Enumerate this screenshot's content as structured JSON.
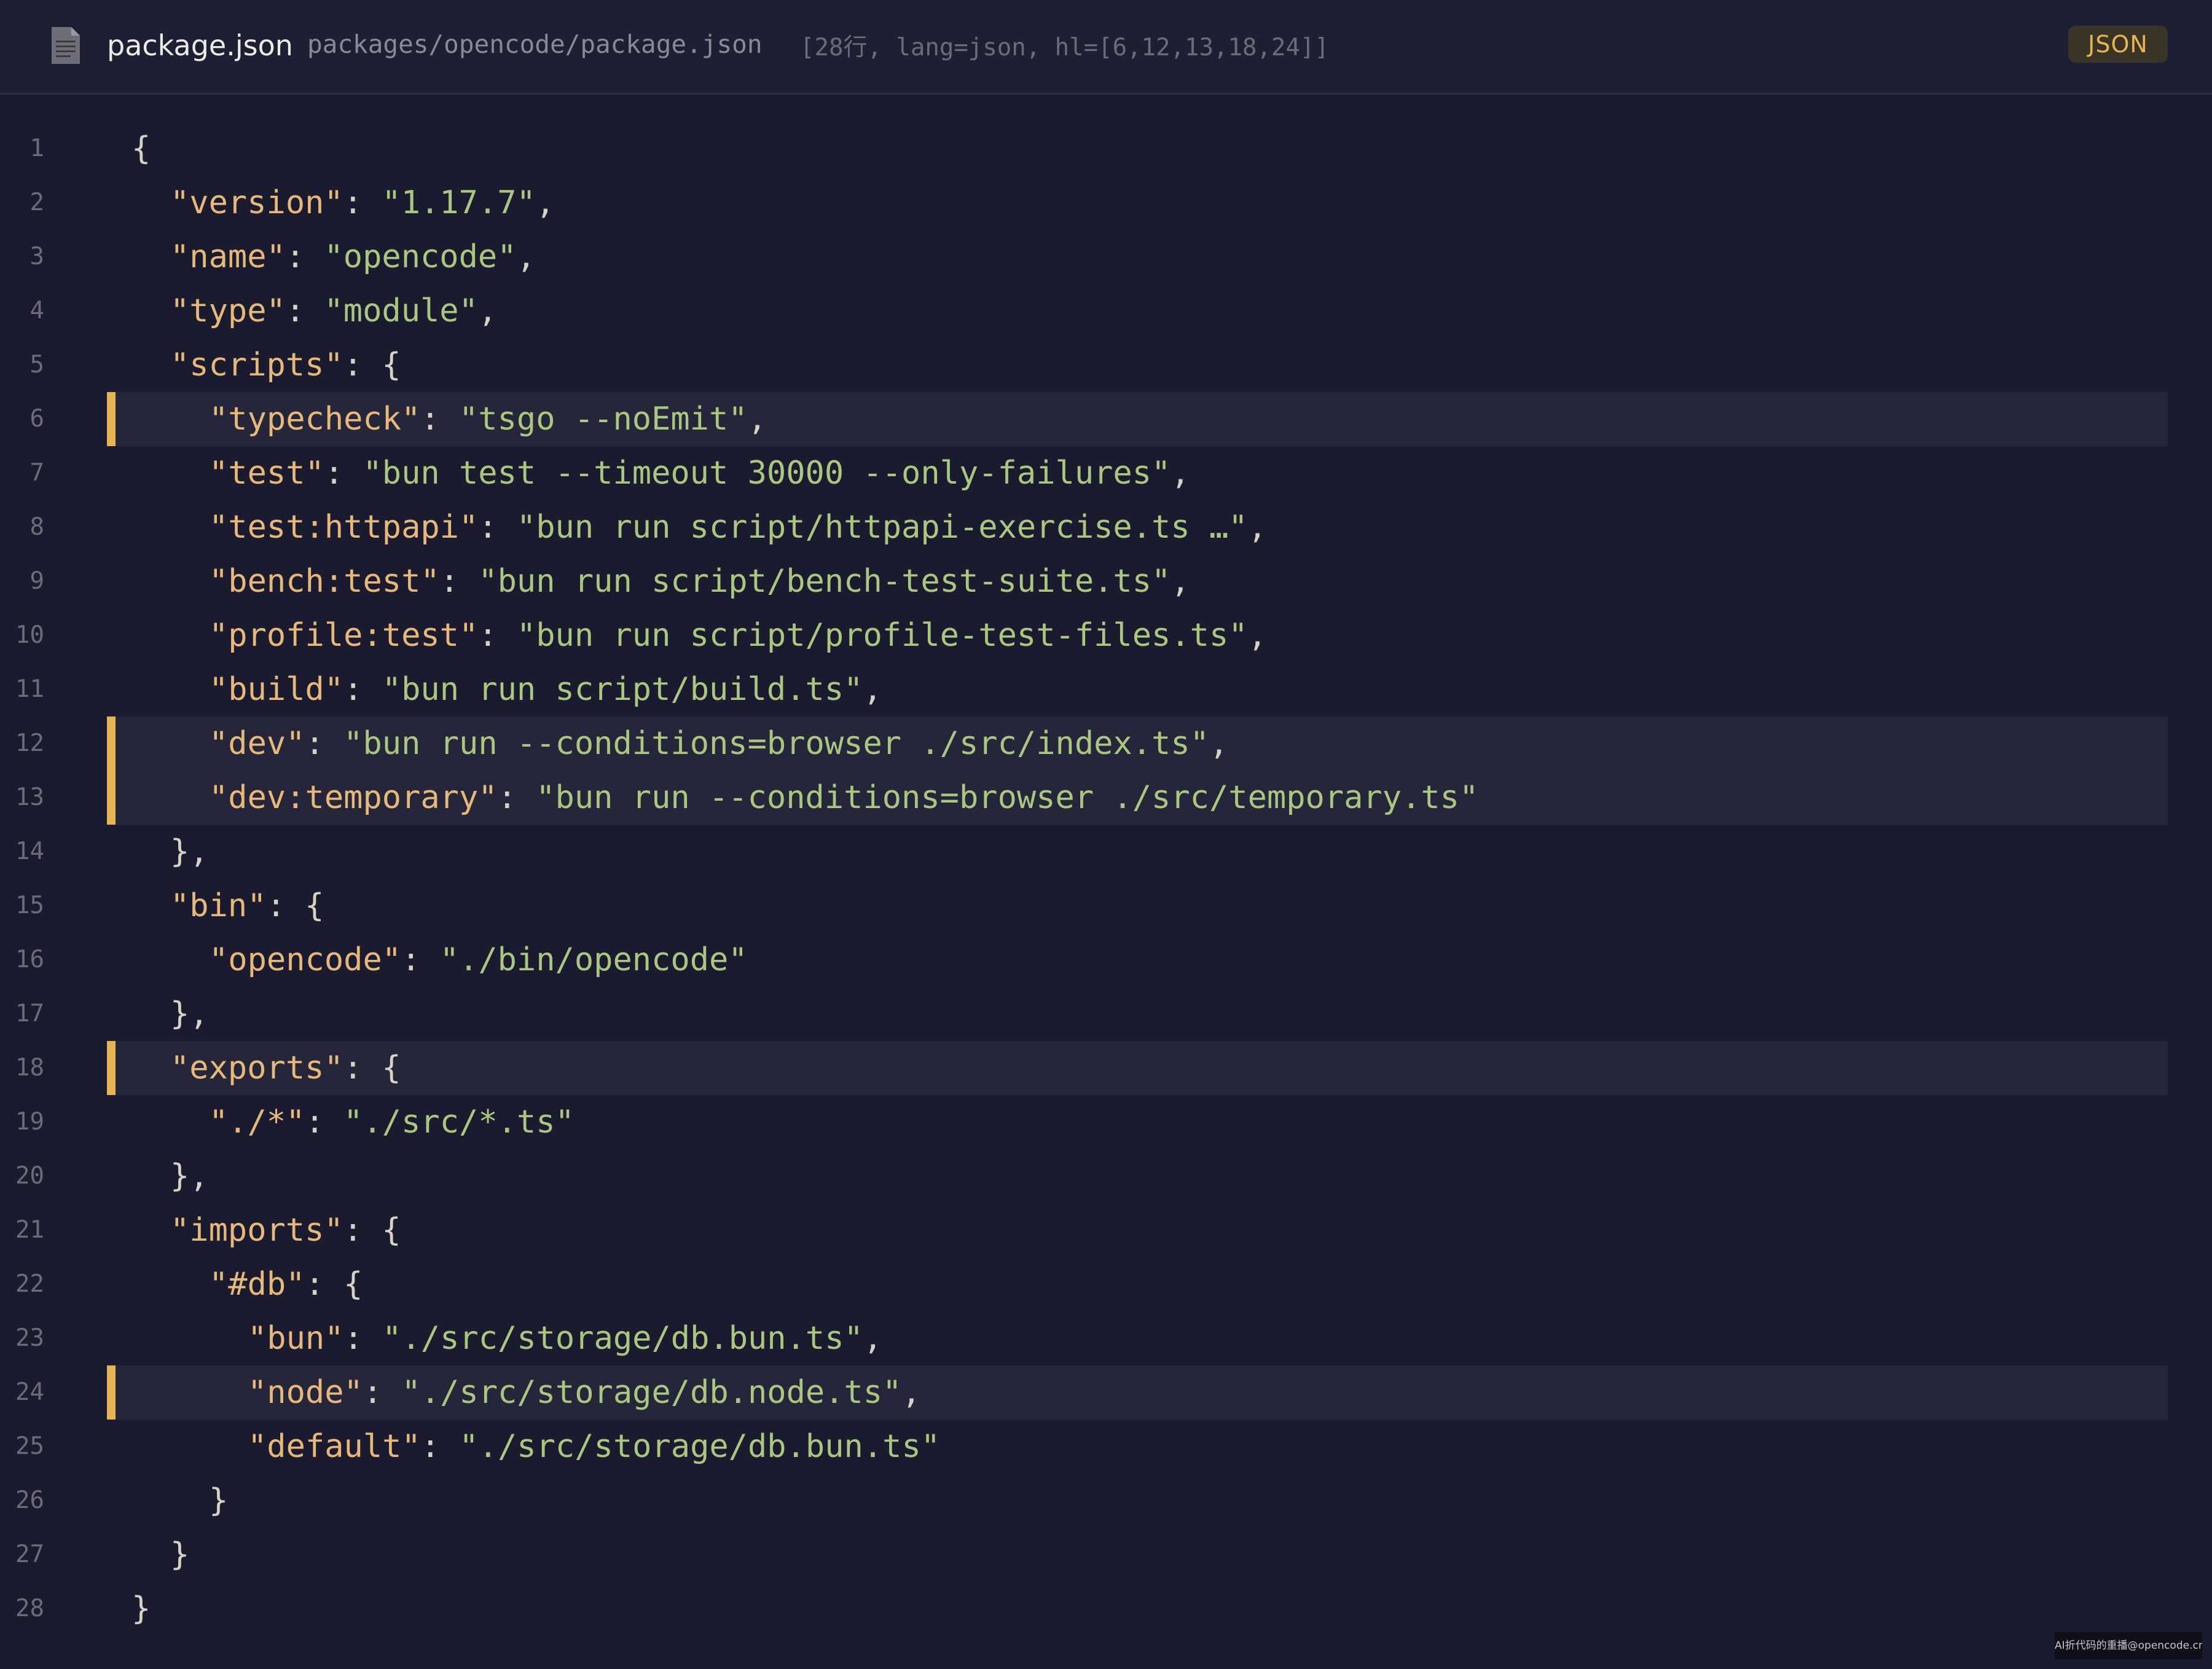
{
  "header": {
    "file_icon": "document-icon",
    "filename": "package.json",
    "filepath": "packages/opencode/package.json",
    "meta": "[28行, lang=json, hl=[6,12,13,18,24]]",
    "language_badge": "JSON"
  },
  "colors": {
    "background": "#1a1b2e",
    "header_background": "#1d1f33",
    "highlight_bar": "#e6b450",
    "highlight_background": "#26263a",
    "key": "#e6b97a",
    "string": "#a9c77e",
    "line_number": "#6c6c78"
  },
  "code": {
    "highlighted_lines": [
      6,
      12,
      13,
      18,
      24
    ],
    "lines": [
      {
        "n": "1",
        "indent": 0,
        "tokens": [
          {
            "t": "pun",
            "v": "{"
          }
        ]
      },
      {
        "n": "2",
        "indent": 1,
        "tokens": [
          {
            "t": "key",
            "v": "\"version\""
          },
          {
            "t": "pun",
            "v": ": "
          },
          {
            "t": "str",
            "v": "\"1.17.7\""
          },
          {
            "t": "pun",
            "v": ","
          }
        ]
      },
      {
        "n": "3",
        "indent": 1,
        "tokens": [
          {
            "t": "key",
            "v": "\"name\""
          },
          {
            "t": "pun",
            "v": ": "
          },
          {
            "t": "str",
            "v": "\"opencode\""
          },
          {
            "t": "pun",
            "v": ","
          }
        ]
      },
      {
        "n": "4",
        "indent": 1,
        "tokens": [
          {
            "t": "key",
            "v": "\"type\""
          },
          {
            "t": "pun",
            "v": ": "
          },
          {
            "t": "str",
            "v": "\"module\""
          },
          {
            "t": "pun",
            "v": ","
          }
        ]
      },
      {
        "n": "5",
        "indent": 1,
        "tokens": [
          {
            "t": "key",
            "v": "\"scripts\""
          },
          {
            "t": "pun",
            "v": ": {"
          }
        ]
      },
      {
        "n": "6",
        "indent": 2,
        "tokens": [
          {
            "t": "key",
            "v": "\"typecheck\""
          },
          {
            "t": "pun",
            "v": ": "
          },
          {
            "t": "str",
            "v": "\"tsgo --noEmit\""
          },
          {
            "t": "pun",
            "v": ","
          }
        ]
      },
      {
        "n": "7",
        "indent": 2,
        "tokens": [
          {
            "t": "key",
            "v": "\"test\""
          },
          {
            "t": "pun",
            "v": ": "
          },
          {
            "t": "str",
            "v": "\"bun test --timeout 30000 --only-failures\""
          },
          {
            "t": "pun",
            "v": ","
          }
        ]
      },
      {
        "n": "8",
        "indent": 2,
        "tokens": [
          {
            "t": "key",
            "v": "\"test:httpapi\""
          },
          {
            "t": "pun",
            "v": ": "
          },
          {
            "t": "str",
            "v": "\"bun run script/httpapi-exercise.ts …\""
          },
          {
            "t": "pun",
            "v": ","
          }
        ]
      },
      {
        "n": "9",
        "indent": 2,
        "tokens": [
          {
            "t": "key",
            "v": "\"bench:test\""
          },
          {
            "t": "pun",
            "v": ": "
          },
          {
            "t": "str",
            "v": "\"bun run script/bench-test-suite.ts\""
          },
          {
            "t": "pun",
            "v": ","
          }
        ]
      },
      {
        "n": "10",
        "indent": 2,
        "tokens": [
          {
            "t": "key",
            "v": "\"profile:test\""
          },
          {
            "t": "pun",
            "v": ": "
          },
          {
            "t": "str",
            "v": "\"bun run script/profile-test-files.ts\""
          },
          {
            "t": "pun",
            "v": ","
          }
        ]
      },
      {
        "n": "11",
        "indent": 2,
        "tokens": [
          {
            "t": "key",
            "v": "\"build\""
          },
          {
            "t": "pun",
            "v": ": "
          },
          {
            "t": "str",
            "v": "\"bun run script/build.ts\""
          },
          {
            "t": "pun",
            "v": ","
          }
        ]
      },
      {
        "n": "12",
        "indent": 2,
        "tokens": [
          {
            "t": "key",
            "v": "\"dev\""
          },
          {
            "t": "pun",
            "v": ": "
          },
          {
            "t": "str",
            "v": "\"bun run --conditions=browser ./src/index.ts\""
          },
          {
            "t": "pun",
            "v": ","
          }
        ]
      },
      {
        "n": "13",
        "indent": 2,
        "tokens": [
          {
            "t": "key",
            "v": "\"dev:temporary\""
          },
          {
            "t": "pun",
            "v": ": "
          },
          {
            "t": "str",
            "v": "\"bun run --conditions=browser ./src/temporary.ts\""
          }
        ]
      },
      {
        "n": "14",
        "indent": 1,
        "tokens": [
          {
            "t": "pun",
            "v": "},"
          }
        ]
      },
      {
        "n": "15",
        "indent": 1,
        "tokens": [
          {
            "t": "key",
            "v": "\"bin\""
          },
          {
            "t": "pun",
            "v": ": {"
          }
        ]
      },
      {
        "n": "16",
        "indent": 2,
        "tokens": [
          {
            "t": "key",
            "v": "\"opencode\""
          },
          {
            "t": "pun",
            "v": ": "
          },
          {
            "t": "str",
            "v": "\"./bin/opencode\""
          }
        ]
      },
      {
        "n": "17",
        "indent": 1,
        "tokens": [
          {
            "t": "pun",
            "v": "},"
          }
        ]
      },
      {
        "n": "18",
        "indent": 1,
        "tokens": [
          {
            "t": "key",
            "v": "\"exports\""
          },
          {
            "t": "pun",
            "v": ": {"
          }
        ]
      },
      {
        "n": "19",
        "indent": 2,
        "tokens": [
          {
            "t": "key",
            "v": "\"./*\""
          },
          {
            "t": "pun",
            "v": ": "
          },
          {
            "t": "str",
            "v": "\"./src/*.ts\""
          }
        ]
      },
      {
        "n": "20",
        "indent": 1,
        "tokens": [
          {
            "t": "pun",
            "v": "},"
          }
        ]
      },
      {
        "n": "21",
        "indent": 1,
        "tokens": [
          {
            "t": "key",
            "v": "\"imports\""
          },
          {
            "t": "pun",
            "v": ": {"
          }
        ]
      },
      {
        "n": "22",
        "indent": 2,
        "tokens": [
          {
            "t": "key",
            "v": "\"#db\""
          },
          {
            "t": "pun",
            "v": ": {"
          }
        ]
      },
      {
        "n": "23",
        "indent": 3,
        "tokens": [
          {
            "t": "key",
            "v": "\"bun\""
          },
          {
            "t": "pun",
            "v": ": "
          },
          {
            "t": "str",
            "v": "\"./src/storage/db.bun.ts\""
          },
          {
            "t": "pun",
            "v": ","
          }
        ]
      },
      {
        "n": "24",
        "indent": 3,
        "tokens": [
          {
            "t": "key",
            "v": "\"node\""
          },
          {
            "t": "pun",
            "v": ": "
          },
          {
            "t": "str",
            "v": "\"./src/storage/db.node.ts\""
          },
          {
            "t": "pun",
            "v": ","
          }
        ]
      },
      {
        "n": "25",
        "indent": 3,
        "tokens": [
          {
            "t": "key",
            "v": "\"default\""
          },
          {
            "t": "pun",
            "v": ": "
          },
          {
            "t": "str",
            "v": "\"./src/storage/db.bun.ts\""
          }
        ]
      },
      {
        "n": "26",
        "indent": 2,
        "tokens": [
          {
            "t": "pun",
            "v": "}"
          }
        ]
      },
      {
        "n": "27",
        "indent": 1,
        "tokens": [
          {
            "t": "pun",
            "v": "}"
          }
        ]
      },
      {
        "n": "28",
        "indent": 0,
        "tokens": [
          {
            "t": "pun",
            "v": "}"
          }
        ]
      }
    ]
  },
  "watermark": "AI折代码的重播@opencode.cn"
}
